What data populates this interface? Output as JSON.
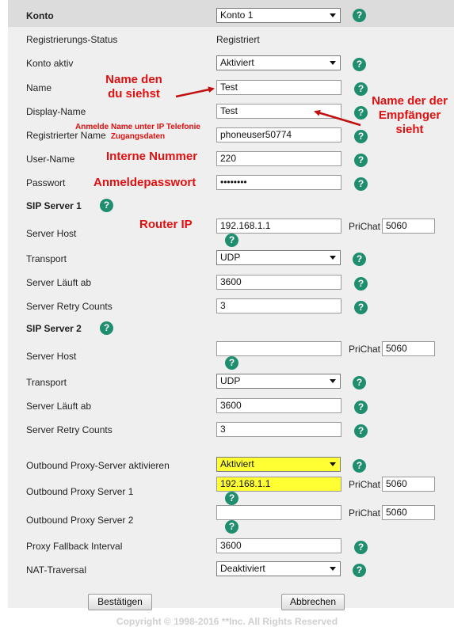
{
  "header": {
    "label": "Konto",
    "select_value": "Konto 1"
  },
  "rows": {
    "reg_status": {
      "label": "Registrierungs-Status",
      "value": "Registriert"
    },
    "konto_aktiv": {
      "label": "Konto aktiv",
      "value": "Aktiviert"
    },
    "name": {
      "label": "Name",
      "value": "Test"
    },
    "display_name": {
      "label": "Display-Name",
      "value": "Test"
    },
    "reg_name": {
      "label": "Registrierter Name",
      "value": "phoneuser50774"
    },
    "user_name": {
      "label": "User-Name",
      "value": "220"
    },
    "passwort": {
      "label": "Passwort",
      "value": "••••••••"
    }
  },
  "sip1": {
    "title": "SIP Server 1",
    "server_host": {
      "label": "Server Host",
      "value": "192.168.1.1",
      "port_label": "PriChat",
      "port": "5060"
    },
    "transport": {
      "label": "Transport",
      "value": "UDP"
    },
    "expires": {
      "label": "Server Läuft ab",
      "value": "3600"
    },
    "retry": {
      "label": "Server Retry Counts",
      "value": "3"
    }
  },
  "sip2": {
    "title": "SIP Server 2",
    "server_host": {
      "label": "Server Host",
      "value": "",
      "port_label": "PriChat",
      "port": "5060"
    },
    "transport": {
      "label": "Transport",
      "value": "UDP"
    },
    "expires": {
      "label": "Server Läuft ab",
      "value": "3600"
    },
    "retry": {
      "label": "Server Retry Counts",
      "value": "3"
    }
  },
  "proxy": {
    "enable": {
      "label": "Outbound Proxy-Server aktivieren",
      "value": "Aktiviert"
    },
    "server1": {
      "label": "Outbound Proxy Server 1",
      "value": "192.168.1.1",
      "port_label": "PriChat",
      "port": "5060"
    },
    "server2": {
      "label": "Outbound Proxy Server 2",
      "value": "",
      "port_label": "PriChat",
      "port": "5060"
    },
    "fallback": {
      "label": "Proxy Fallback Interval",
      "value": "3600"
    },
    "nat": {
      "label": "NAT-Traversal",
      "value": "Deaktiviert"
    }
  },
  "buttons": {
    "confirm": "Bestätigen",
    "cancel": "Abbrechen"
  },
  "footer": "Copyright © 1998-2016 **Inc. All Rights Reserved",
  "help_glyph": "?",
  "annotations": {
    "name_line1": "Name den",
    "name_line2": "du siehst",
    "display_line1": "Name der der",
    "display_line2": "Empfänger",
    "display_line3": "sieht",
    "reg_line1": "Anmelde Name unter IP Telefonie",
    "reg_line2": "Zugangsdaten",
    "user": "Interne Nummer",
    "pass": "Anmeldepasswort",
    "router": "Router IP"
  },
  "colors": {
    "help": "#1e8e6e",
    "annotation": "#e01010",
    "highlight": "#ffff33"
  }
}
